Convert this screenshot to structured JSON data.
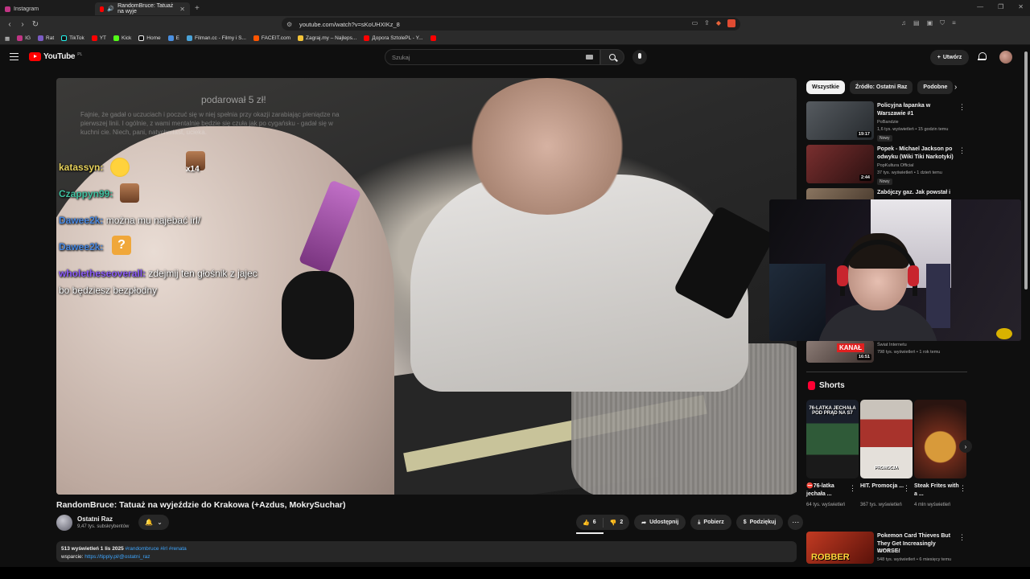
{
  "browser": {
    "tabs": [
      {
        "label": "Instagram",
        "color": "#c13584",
        "active": false
      },
      {
        "label": "RandomBruce: Tatuaż na wyje",
        "color": "#ff0000",
        "active": true
      }
    ],
    "url": "youtube.com/watch?v=sKoUHXIKz_8",
    "brave_badge_count": "2",
    "bookmarks": [
      "IG",
      "Rat",
      "TikTok",
      "YT",
      "Kick",
      "Home",
      "E",
      "Filman.cc - Filmy i S...",
      "FACEIT.com",
      "Zagraj.my – Najleps...",
      "Дорога SztolePL - Y..."
    ]
  },
  "youtube": {
    "logo": "YouTube",
    "country": "PL",
    "search_placeholder": "Szukaj",
    "create_label": "Utwórz"
  },
  "video_overlay": {
    "headline": "podarował 5 zł!",
    "dimmed_text": "Fajnie, że gadał o uczuciach i poczuć się w niej spełnia przy okazji zarabiając pieniądze na pierwszej linii. I ogólnie, z wami mentalnie będzie się czuła jak po cygańsku - gadał się w kuchni cie. Niech, pani, natychmiast, ucieka.",
    "chat": [
      {
        "user": "katassyn:",
        "msg": ""
      },
      {
        "user": "Czappyn99:",
        "msg": ""
      },
      {
        "user": "Dawee2k:",
        "msg": " można mu najebać irl/"
      },
      {
        "user": "Dawee2k:",
        "msg": ""
      },
      {
        "user": "wholetheseoverall:",
        "msg": " zdejmij ten głośnik z jajec"
      },
      {
        "user": "",
        "msg": "bo będziesz bezpłodny"
      }
    ],
    "emote_count": "x14",
    "emote_question": "?"
  },
  "video": {
    "title": "RandomBruce: Tatuaż na wyjeździe do Krakowa (+Azdus, MokrySuchar)",
    "channel": "Ostatni Raz",
    "subscribers": "9,47 tys. subskrybentów",
    "likes": "6",
    "dislikes": "2",
    "share_label": "Udostępnij",
    "download_label": "Pobierz",
    "thanks_label": "Podziękuj",
    "desc_meta": "513 wyświetleń  1 lis 2025",
    "desc_tags": "#randombruce #irl #renata",
    "desc_support_label": "wsparcie:",
    "desc_link": "https://tipply.pl/@ostatni_raz"
  },
  "sidebar": {
    "chips": [
      "Wszystkie",
      "Źródło: Ostatni Raz",
      "Podobne"
    ],
    "recommendations": [
      {
        "title": "Policyjna łapanka w Warszawie #1",
        "channel": "PoBandzie",
        "meta": "1,6 tys. wyświetleń • 15 godzin temu",
        "badge": "Nowy",
        "duration": "19:17",
        "thumb": "#3b3f44"
      },
      {
        "title": "Popek - Michael Jackson po odwyku (Wiki Tiki Narkotyki)",
        "channel": "PopKultura Official",
        "meta": "37 tys. wyświetleń • 1 dzień temu",
        "badge": "Nowy",
        "duration": "2:44",
        "thumb": "#5a2a2a"
      },
      {
        "title": "Zabójczy gaz. Jak powstał i",
        "channel": "",
        "meta": "",
        "badge": "",
        "duration": "",
        "thumb": "#6b5a4a"
      },
      {
        "title": "",
        "channel": "Świat Internetu",
        "meta": "798 tys. wyświetleń • 1 rok temu",
        "badge": "",
        "duration": "16:51",
        "thumb": "#7a6b66",
        "kanal": "KANAŁ"
      }
    ],
    "shorts_title": "Shorts",
    "shorts": [
      {
        "title": "⛔76-latka jechała ...",
        "views": "64 tys. wyświetleń",
        "overlay": "76-LATKA JECHAŁA POD PRĄD NA S7",
        "color": "#2f4d34"
      },
      {
        "title": "HIT. Promocja ...",
        "views": "367 tys. wyświetleń",
        "overlay": "PROMOCJA",
        "color": "#9a3b33"
      },
      {
        "title": "Steak Frites with a ...",
        "views": "4 mln wyświetleń",
        "overlay": "",
        "color": "#8a4a2a"
      }
    ],
    "bottom_rec": {
      "title": "Pokemon Card Thieves But They Get Increasingly WORSE!",
      "channel": "GTC Cards",
      "meta": "548 tys. wyświetleń • 6 miesięcy temu",
      "thumb_text": "ROBBER",
      "thumb": "#b03020"
    }
  }
}
